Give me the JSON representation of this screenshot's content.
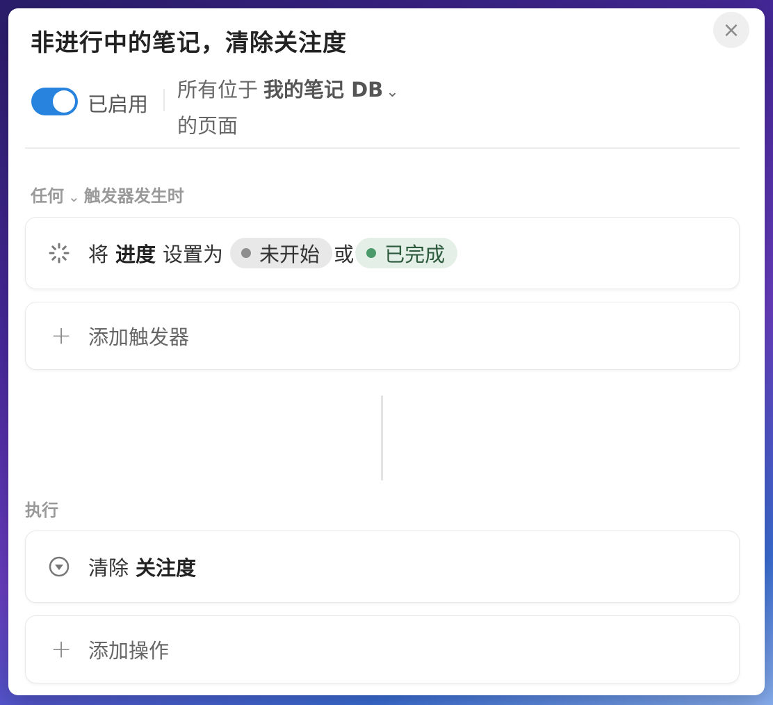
{
  "dialog": {
    "title": "非进行中的笔记，清除关注度",
    "close_icon": "×"
  },
  "status": {
    "enabled": true,
    "label": "已启用"
  },
  "scope": {
    "prefix": "所有位于",
    "database": "我的笔记 DB",
    "suffix": "的页面"
  },
  "trigger_section": {
    "mode": "任何",
    "label": "触发器发生时"
  },
  "trigger": {
    "verb": "将",
    "property": "进度",
    "set_to": "设置为",
    "or": "或",
    "values": [
      {
        "label": "未开始",
        "color": "#8e8e8e",
        "bg": "#e8e8e8"
      },
      {
        "label": "已完成",
        "color": "#4a9a6a",
        "bg": "#e3efe7"
      }
    ]
  },
  "add_trigger": {
    "label": "添加触发器"
  },
  "action_section": {
    "label": "执行"
  },
  "action": {
    "verb": "清除",
    "property": "关注度"
  },
  "add_action": {
    "label": "添加操作"
  },
  "colors": {
    "accent": "#2783de"
  }
}
